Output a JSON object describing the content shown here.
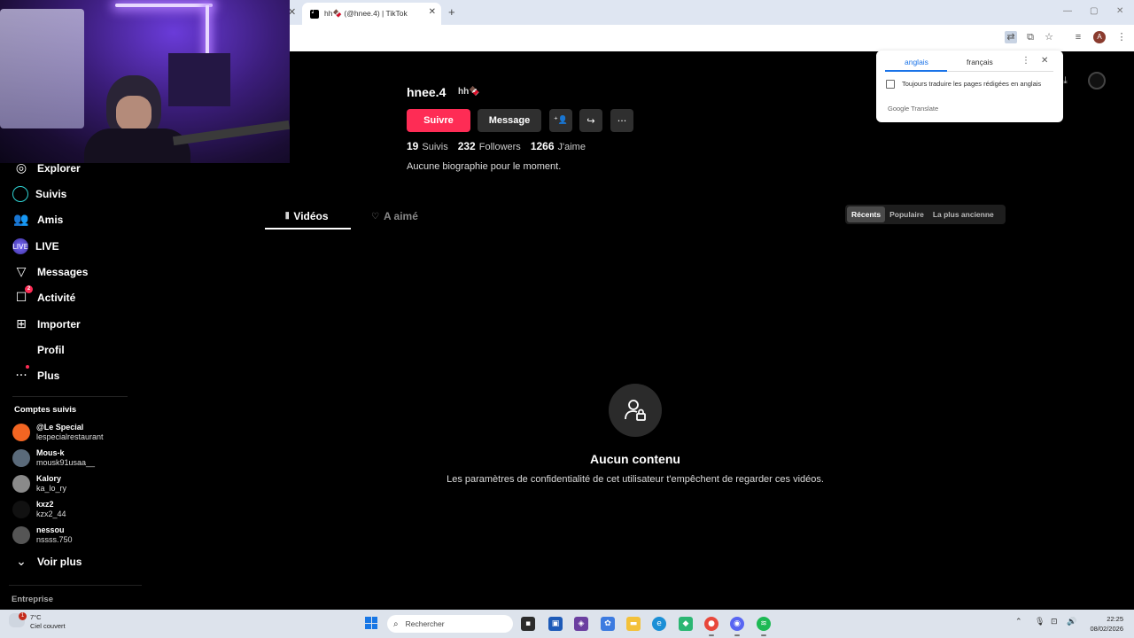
{
  "browser": {
    "tab_title": "hh🍫 (@hnee.4) | TikTok",
    "tab_close": "✕",
    "left_close": "✕",
    "new_tab": "+",
    "win_min": "—",
    "win_max": "▢",
    "win_close": "✕",
    "profile_initial": "A"
  },
  "translate_popup": {
    "source_lang": "anglais",
    "target_lang": "français",
    "more": "⋮",
    "close": "✕",
    "always_translate_label": "Toujours traduire les pages rédigées en anglais",
    "brand": "Google Translate"
  },
  "sidebar": {
    "items": [
      {
        "label": "Explorer",
        "icon": "compass-icon",
        "glyph": "◎"
      },
      {
        "label": "Suivis",
        "icon": "following-icon",
        "glyph": ""
      },
      {
        "label": "Amis",
        "icon": "friends-icon",
        "glyph": "👥"
      },
      {
        "label": "LIVE",
        "icon": "live-icon",
        "glyph": "LIVE"
      },
      {
        "label": "Messages",
        "icon": "messages-icon",
        "glyph": "▽"
      },
      {
        "label": "Activité",
        "icon": "activity-icon",
        "glyph": "☐",
        "badge": "2"
      },
      {
        "label": "Importer",
        "icon": "upload-icon",
        "glyph": "⊞"
      },
      {
        "label": "Profil",
        "icon": "profile-icon",
        "glyph": ""
      },
      {
        "label": "Plus",
        "icon": "more-icon",
        "glyph": "···"
      }
    ],
    "followed_title": "Comptes suivis",
    "followed": [
      {
        "display": "@Le Special",
        "handle": "lespecialrestaurant",
        "color": "#f26522"
      },
      {
        "display": "Mous-k",
        "handle": "mousk91usaa__",
        "color": "#5a6a7a"
      },
      {
        "display": "Kalory",
        "handle": "ka_lo_ry",
        "color": "#8a8a8a"
      },
      {
        "display": "kxz2",
        "handle": "kzx2_44",
        "color": "#111111"
      },
      {
        "display": "nessou",
        "handle": "nssss.750",
        "color": "#555555"
      }
    ],
    "see_more": "Voir plus",
    "see_more_icon": "⌄",
    "company": "Entreprise"
  },
  "profile": {
    "username": "hnee.4",
    "nickname": "hh🍫",
    "follow_button": "Suivre",
    "message_button": "Message",
    "add_friend_glyph": "⁺👤",
    "share_glyph": "↪",
    "more_glyph": "···",
    "following_count": "19",
    "following_label": "Suivis",
    "followers_count": "232",
    "followers_label": "Followers",
    "likes_count": "1266",
    "likes_label": "J'aime",
    "bio": "Aucune biographie pour le moment."
  },
  "content_tabs": [
    {
      "label": "Vidéos",
      "icon": "grid-icon",
      "glyph": "⦀"
    },
    {
      "label": "A aimé",
      "icon": "liked-icon",
      "glyph": "♡"
    }
  ],
  "sort_options": [
    {
      "label": "Récents",
      "active": true
    },
    {
      "label": "Populaire",
      "active": false
    },
    {
      "label": "La plus ancienne",
      "active": false
    }
  ],
  "empty_state": {
    "title": "Aucun contenu",
    "description": "Les paramètres de confidentialité de cet utilisateur t'empêchent de regarder ces vidéos."
  },
  "taskbar": {
    "weather_temp": "7°C",
    "weather_desc": "Ciel couvert",
    "weather_badge": "1",
    "search_placeholder": "Rechercher",
    "time": "22:25",
    "date": "08/02/2026"
  }
}
